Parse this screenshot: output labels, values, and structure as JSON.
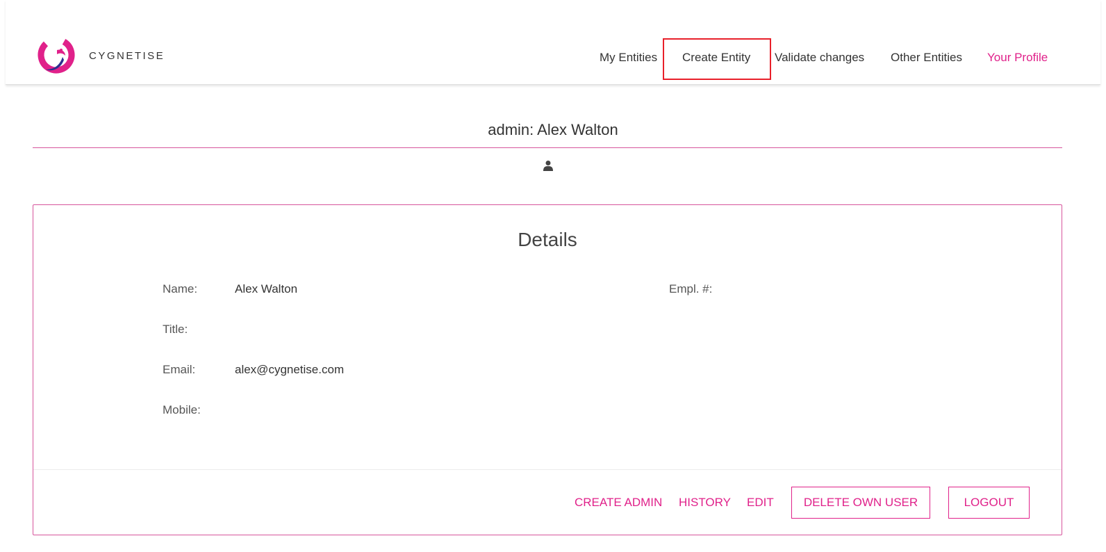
{
  "brand": {
    "name": "CYGNETISE",
    "accent": "#e0218a",
    "secondary": "#2b2f8f"
  },
  "nav": {
    "items": [
      {
        "label": "My Entities"
      },
      {
        "label": "Create Entity"
      },
      {
        "label": "Validate changes"
      },
      {
        "label": "Other Entities"
      },
      {
        "label": "Your Profile",
        "active": true
      }
    ]
  },
  "profile": {
    "title": "admin: Alex Walton",
    "icon": "user-icon"
  },
  "details": {
    "heading": "Details",
    "fields": {
      "name": {
        "label": "Name:",
        "value": "Alex Walton"
      },
      "empl": {
        "label": "Empl. #:",
        "value": ""
      },
      "title": {
        "label": "Title:",
        "value": ""
      },
      "email": {
        "label": "Email:",
        "value": "alex@cygnetise.com"
      },
      "mobile": {
        "label": "Mobile:",
        "value": ""
      }
    }
  },
  "actions": {
    "create_admin": "CREATE ADMIN",
    "history": "HISTORY",
    "edit": "EDIT",
    "delete_own_user": "DELETE OWN USER",
    "logout": "LOGOUT"
  }
}
